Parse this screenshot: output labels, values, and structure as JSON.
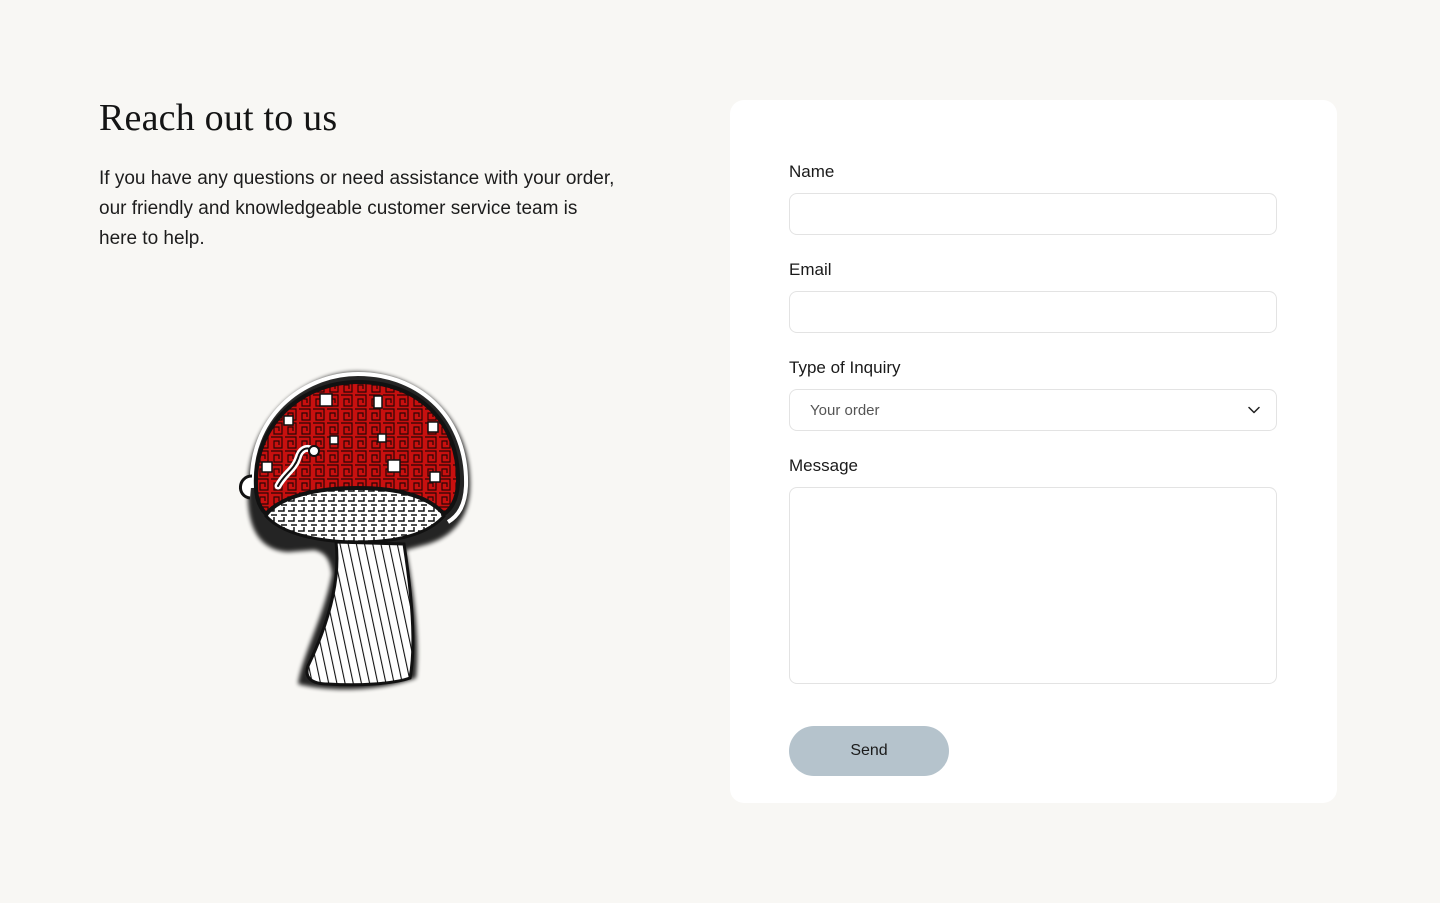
{
  "contact": {
    "title": "Reach out to us",
    "description": "If you have any questions or need assistance with your order, our friendly and knowledgeable customer service team is here to help."
  },
  "illustration": {
    "icon": "mushroom-illustration",
    "cap_color": "#c8100f",
    "outline_color": "#111111"
  },
  "form": {
    "name_label": "Name",
    "name_value": "",
    "email_label": "Email",
    "email_value": "",
    "inquiry_label": "Type of Inquiry",
    "inquiry_selected": "Your order",
    "message_label": "Message",
    "message_value": "",
    "send_label": "Send"
  },
  "colors": {
    "page_background": "#f8f7f4",
    "card_background": "#ffffff",
    "send_button": "#b5c3cc"
  }
}
